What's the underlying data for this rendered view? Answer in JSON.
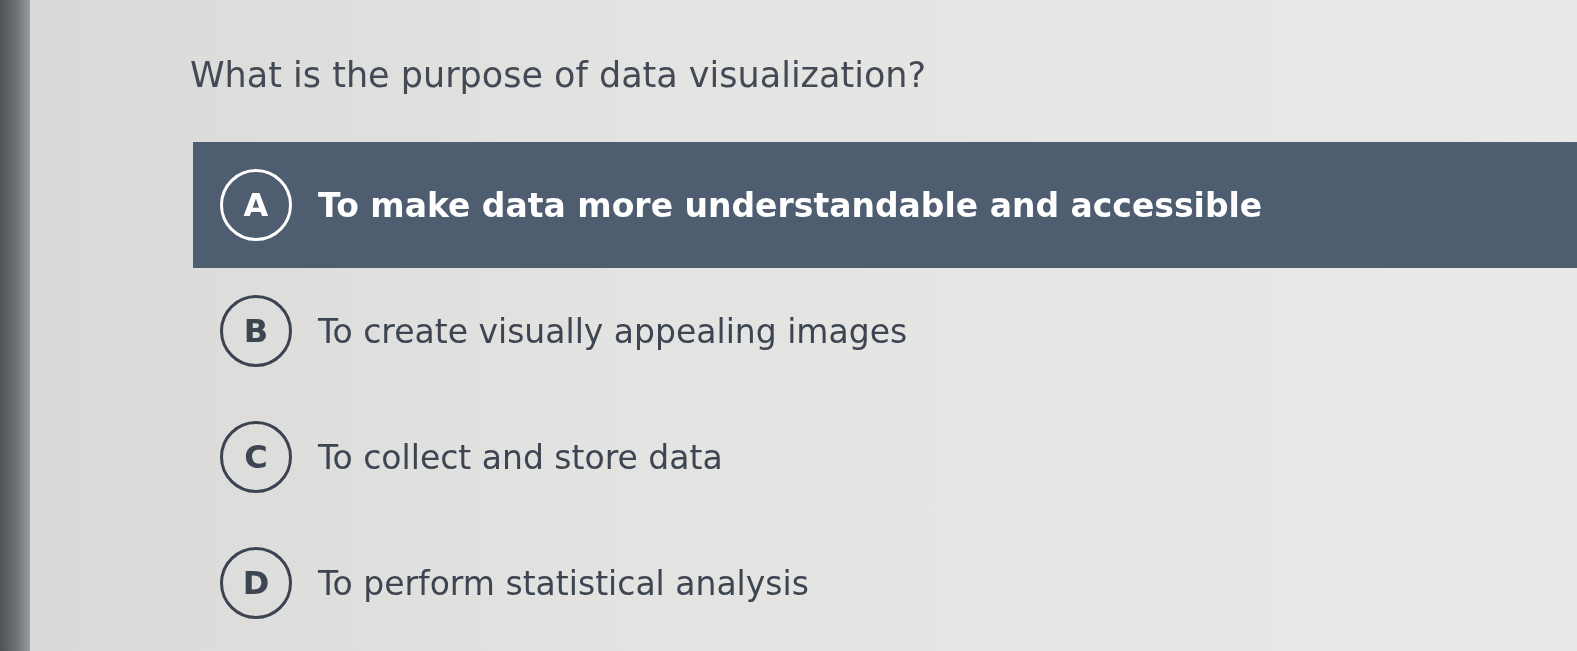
{
  "question": {
    "text": "What is the purpose of data visualization?"
  },
  "options": [
    {
      "letter": "A",
      "text": "To make data more understandable and accessible",
      "selected": true
    },
    {
      "letter": "B",
      "text": "To create visually appealing images",
      "selected": false
    },
    {
      "letter": "C",
      "text": "To collect and store data",
      "selected": false
    },
    {
      "letter": "D",
      "text": "To perform statistical analysis",
      "selected": false
    }
  ]
}
